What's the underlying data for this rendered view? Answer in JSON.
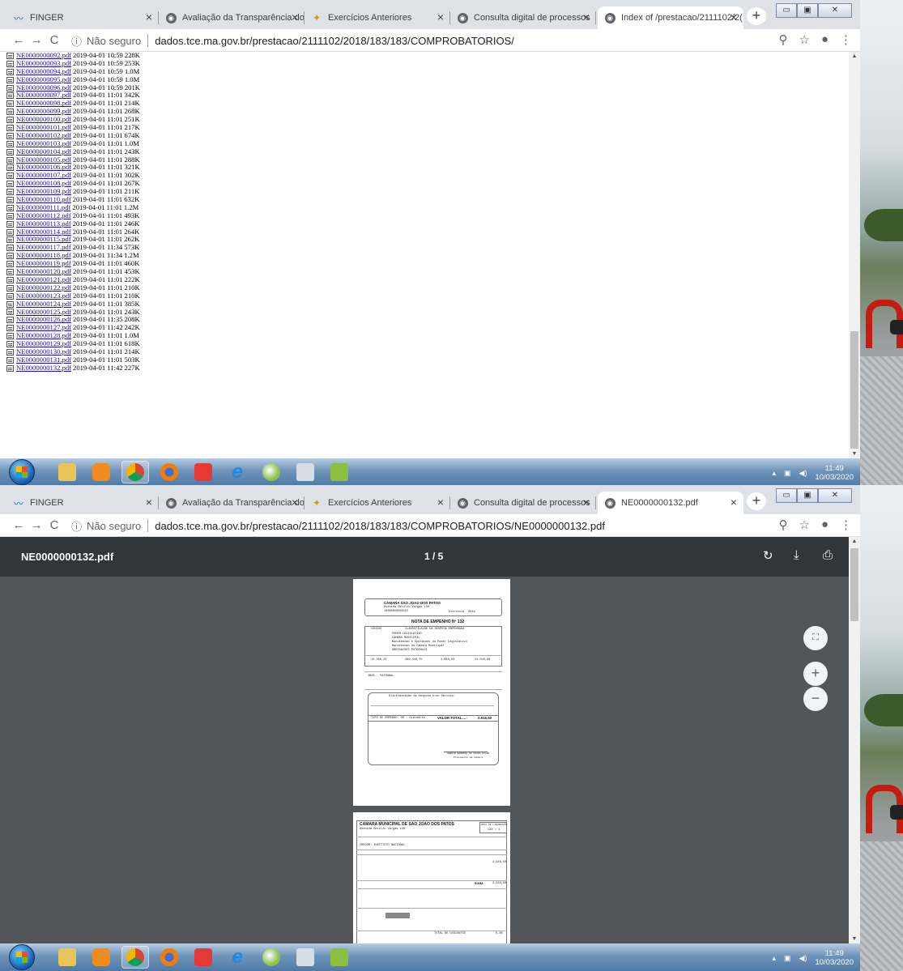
{
  "screenshot_1": {
    "tabs": [
      {
        "title": "FINGER",
        "icon": "finger-icon"
      },
      {
        "title": "Avaliação da Transparência dos",
        "icon": "globe-icon"
      },
      {
        "title": "Exercícios Anteriores",
        "icon": "emblem-icon"
      },
      {
        "title": "Consulta digital de processos",
        "icon": "globe-icon"
      },
      {
        "title": "Index of /prestacao/2111102/2(",
        "icon": "globe-icon"
      }
    ],
    "omnibox": {
      "security_label": "Não seguro",
      "url": "dados.tce.ma.gov.br/prestacao/2111102/2018/183/183/COMPROBATORIOS/"
    },
    "files": [
      {
        "name": "NE0000000092.pdf",
        "date": "2019-04-01 10:59",
        "size": "228K"
      },
      {
        "name": "NE0000000093.pdf",
        "date": "2019-04-01 10:59",
        "size": "253K"
      },
      {
        "name": "NE0000000094.pdf",
        "date": "2019-04-01 10:59",
        "size": "1.0M"
      },
      {
        "name": "NE0000000095.pdf",
        "date": "2019-04-01 10:59",
        "size": "1.0M"
      },
      {
        "name": "NE0000000096.pdf",
        "date": "2019-04-01 10:59",
        "size": "201K"
      },
      {
        "name": "NE0000000097.pdf",
        "date": "2019-04-01 11:01",
        "size": "342K"
      },
      {
        "name": "NE0000000098.pdf",
        "date": "2019-04-01 11:01",
        "size": "214K"
      },
      {
        "name": "NE0000000099.pdf",
        "date": "2019-04-01 11:01",
        "size": "268K"
      },
      {
        "name": "NE0000000100.pdf",
        "date": "2019-04-01 11:01",
        "size": "251K"
      },
      {
        "name": "NE0000000101.pdf",
        "date": "2019-04-01 11:01",
        "size": "217K"
      },
      {
        "name": "NE0000000102.pdf",
        "date": "2019-04-01 11:01",
        "size": "674K"
      },
      {
        "name": "NE0000000103.pdf",
        "date": "2019-04-01 11:01",
        "size": "1.0M"
      },
      {
        "name": "NE0000000104.pdf",
        "date": "2019-04-01 11:01",
        "size": "243K"
      },
      {
        "name": "NE0000000105.pdf",
        "date": "2019-04-01 11:01",
        "size": "288K"
      },
      {
        "name": "NE0000000106.pdf",
        "date": "2019-04-01 11:01",
        "size": "321K"
      },
      {
        "name": "NE0000000107.pdf",
        "date": "2019-04-01 11:01",
        "size": "302K"
      },
      {
        "name": "NE0000000108.pdf",
        "date": "2019-04-01 11:01",
        "size": "267K"
      },
      {
        "name": "NE0000000109.pdf",
        "date": "2019-04-01 11:01",
        "size": "211K"
      },
      {
        "name": "NE0000000110.pdf",
        "date": "2019-04-01 11:01",
        "size": "632K"
      },
      {
        "name": "NE0000000111.pdf",
        "date": "2019-04-01 11:01",
        "size": "1.2M"
      },
      {
        "name": "NE0000000112.pdf",
        "date": "2019-04-01 11:01",
        "size": "493K"
      },
      {
        "name": "NE0000000113.pdf",
        "date": "2019-04-01 11:01",
        "size": "246K"
      },
      {
        "name": "NE0000000114.pdf",
        "date": "2019-04-01 11:01",
        "size": "264K"
      },
      {
        "name": "NE0000000115.pdf",
        "date": "2019-04-01 11:01",
        "size": "262K"
      },
      {
        "name": "NE0000000117.pdf",
        "date": "2019-04-01 11:34",
        "size": "573K"
      },
      {
        "name": "NE0000000118.pdf",
        "date": "2019-04-01 11:34",
        "size": "1.2M"
      },
      {
        "name": "NE0000000119.pdf",
        "date": "2019-04-01 11:01",
        "size": "460K"
      },
      {
        "name": "NE0000000120.pdf",
        "date": "2019-04-01 11:01",
        "size": "453K"
      },
      {
        "name": "NE0000000121.pdf",
        "date": "2019-04-01 11:01",
        "size": "222K"
      },
      {
        "name": "NE0000000122.pdf",
        "date": "2019-04-01 11:01",
        "size": "210K"
      },
      {
        "name": "NE0000000123.pdf",
        "date": "2019-04-01 11:01",
        "size": "210K"
      },
      {
        "name": "NE0000000124.pdf",
        "date": "2019-04-01 11:01",
        "size": "385K"
      },
      {
        "name": "NE0000000125.pdf",
        "date": "2019-04-01 11:01",
        "size": "243K"
      },
      {
        "name": "NE0000000126.pdf",
        "date": "2019-04-01 11:35",
        "size": "208K"
      },
      {
        "name": "NE0000000127.pdf",
        "date": "2019-04-01 11:42",
        "size": "242K"
      },
      {
        "name": "NE0000000128.pdf",
        "date": "2019-04-01 11:01",
        "size": "1.0M"
      },
      {
        "name": "NE0000000129.pdf",
        "date": "2019-04-01 11:01",
        "size": "618K"
      },
      {
        "name": "NE0000000130.pdf",
        "date": "2019-04-01 11:01",
        "size": "214K"
      },
      {
        "name": "NE0000000131.pdf",
        "date": "2019-04-01 11:01",
        "size": "503K"
      },
      {
        "name": "NE0000000132.pdf",
        "date": "2019-04-01 11:42",
        "size": "227K"
      }
    ],
    "clock": {
      "time": "11:49",
      "date": "10/03/2020"
    }
  },
  "screenshot_2": {
    "tabs": [
      {
        "title": "FINGER",
        "icon": "finger-icon"
      },
      {
        "title": "Avaliação da Transparência dos",
        "icon": "globe-icon"
      },
      {
        "title": "Exercícios Anteriores",
        "icon": "emblem-icon"
      },
      {
        "title": "Consulta digital de processos",
        "icon": "globe-icon"
      },
      {
        "title": "NE0000000132.pdf",
        "icon": "globe-icon"
      }
    ],
    "omnibox": {
      "security_label": "Não seguro",
      "url": "dados.tce.ma.gov.br/prestacao/2111102/2018/183/183/COMPROBATORIOS/NE0000000132.pdf"
    },
    "pdf_viewer": {
      "file_name": "NE0000000132.pdf",
      "page_indicator": "1 / 5"
    },
    "document_page_1": {
      "org_name": "CAMARA SAO JOAO DOS PATOS",
      "address": "Avenida Getulio Vargas 130",
      "cnpj": "10085050000152",
      "exercise_label": "Exercício",
      "exercise_year": "2018",
      "title": "NOTA DE EMPENHO Nº  132",
      "classification_header": "CLASSIFICAÇÃO DA DESPESA EMPENHADA",
      "code_header": "CÓDIGO",
      "lines": [
        "PODER LEGISLATIVO",
        "CAMARA MUNICIPAL",
        "Manutencao e Operacoes do Poder Legislativo",
        "Manutencao da Camara Municipal",
        "OBRIGACOES PATRONAIS"
      ],
      "values_row": [
        "12.356,22",
        "299.440,75",
        "2.916,50",
        "11.043,98"
      ],
      "creditor": "INSS - PATRONAL",
      "discrimination_title": "Discriminação da Despesa e/ou Serviço:",
      "type_label": "TIPO DE EMPENHO: OR - Ordinário",
      "total_label": "VALOR TOTAL....:",
      "total_value": "2.916,50",
      "signature_name": "ADEMIR BARBOSA DE SOUSA FILHO",
      "signature_role": "Presidente da Câmara"
    },
    "document_page_2": {
      "org_name": "CAMARA MUNICIPAL DE SAO JOAO DOS PATOS",
      "address": "Avenida Getulio Vargas 130",
      "box_title": "NOTA DE LIQUIDAÇÃO",
      "box_value": "128  /  1",
      "creditor": "CREDOR: INSTITUTO NACIONAL",
      "value_1": "2.916,50",
      "value_2": "2.916,50",
      "sum_label": "SOMA",
      "total_label": "TOTAL DE DESCONTOS",
      "total_value": "0,00"
    },
    "clock": {
      "time": "11:49",
      "date": "10/03/2020"
    }
  },
  "taskbar_apps": [
    "windows-start",
    "explorer",
    "media-player",
    "chrome",
    "firefox",
    "snipping-tool",
    "internet-explorer",
    "paint",
    "calculator",
    "finger-app"
  ],
  "colors": {
    "link": "#1a0dab",
    "pdf_toolbar": "#323639",
    "pdf_background": "#525659",
    "tab_strip": "#dee1e6"
  }
}
